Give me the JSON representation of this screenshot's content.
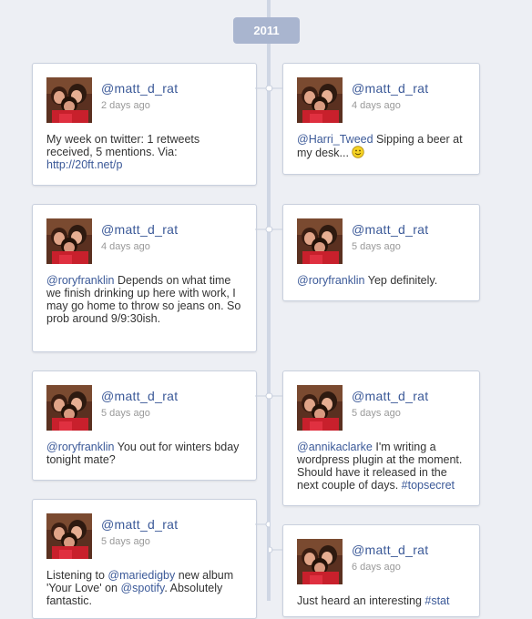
{
  "year": "2011",
  "posts": [
    {
      "handle": "@matt_d_rat",
      "time": "2 days ago",
      "parts": [
        {
          "t": "My week on twitter: 1 retweets received, 5 mentions. Via: "
        },
        {
          "t": "http://20ft.net/p",
          "link": true
        }
      ]
    },
    {
      "handle": "@matt_d_rat",
      "time": "4 days ago",
      "parts": [
        {
          "t": "@Harri_Tweed",
          "link": true
        },
        {
          "t": " Sipping a beer at my desk..."
        }
      ],
      "emoji": "smiley-icon"
    },
    {
      "handle": "@matt_d_rat",
      "time": "4 days ago",
      "parts": [
        {
          "t": "@roryfranklin",
          "link": true
        },
        {
          "t": " Depends on what time we finish drinking up here with work, I may go home to throw so jeans on. So prob around 9/9:30ish."
        }
      ]
    },
    {
      "handle": "@matt_d_rat",
      "time": "5 days ago",
      "parts": [
        {
          "t": "@roryfranklin",
          "link": true
        },
        {
          "t": " Yep definitely."
        }
      ]
    },
    {
      "handle": "@matt_d_rat",
      "time": "5 days ago",
      "parts": [
        {
          "t": "@roryfranklin",
          "link": true
        },
        {
          "t": " You out for winters bday tonight mate?"
        }
      ]
    },
    {
      "handle": "@matt_d_rat",
      "time": "5 days ago",
      "parts": [
        {
          "t": "@annikaclarke",
          "link": true
        },
        {
          "t": " I'm writing a wordpress plugin at the moment. Should have it released in the next couple of days. "
        },
        {
          "t": "#topsecret",
          "link": true
        }
      ]
    },
    {
      "handle": "@matt_d_rat",
      "time": "5 days ago",
      "parts": [
        {
          "t": "Listening to "
        },
        {
          "t": "@mariedigby",
          "link": true
        },
        {
          "t": " new album 'Your Love' on "
        },
        {
          "t": "@spotify",
          "link": true
        },
        {
          "t": ". Absolutely fantastic."
        }
      ]
    },
    {
      "handle": "@matt_d_rat",
      "time": "6 days ago",
      "parts": [
        {
          "t": "Just heard an interesting "
        },
        {
          "t": "#stat",
          "link": true
        }
      ]
    }
  ]
}
